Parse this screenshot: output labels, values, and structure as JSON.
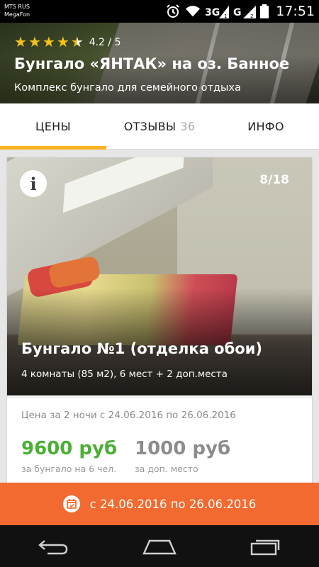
{
  "status": {
    "carrier1": "MTS RUS",
    "carrier2": "MegaFon",
    "net1": "3G",
    "net2": "G",
    "sim1": "1",
    "sim2": "2",
    "time": "17:51",
    "icons": [
      "alarm-icon",
      "wifi-icon",
      "signal-sim1-icon",
      "signal-sim2-icon",
      "battery-icon"
    ]
  },
  "header": {
    "rating": 4.2,
    "rating_text": "4.2 / 5",
    "title": "Бунгало «ЯНТАК» на оз. Банное",
    "subtitle": "Комплекс бунгало для семейного отдыха"
  },
  "tabs": [
    {
      "label": "ЦЕНЫ",
      "count": "",
      "active": true
    },
    {
      "label": "ОТЗЫВЫ",
      "count": "36",
      "active": false
    },
    {
      "label": "ИНФО",
      "count": "",
      "active": false
    }
  ],
  "card": {
    "photo_counter": "8/18",
    "info_icon": "info-icon",
    "room_title": "Бунгало №1 (отделка обои)",
    "room_meta": "4 комнаты (85 м2),   6 мест + 2 доп.места",
    "price_label": "Цена за 2 ночи с 24.06.2016 по 26.06.2016",
    "price_main": "9600 руб",
    "price_main_sub": "за бунгало на 6 чел.",
    "price_extra": "1000 руб",
    "price_extra_sub": "за доп. место"
  },
  "datebar": {
    "icon": "calendar-icon",
    "text": "с 24.06.2016 по 26.06.2016"
  },
  "colors": {
    "accent": "#f5b321",
    "datebar": "#f26a2f",
    "price_green": "#4caf35"
  },
  "navbar": {
    "icons": [
      "back-icon",
      "home-icon",
      "recents-icon"
    ]
  }
}
